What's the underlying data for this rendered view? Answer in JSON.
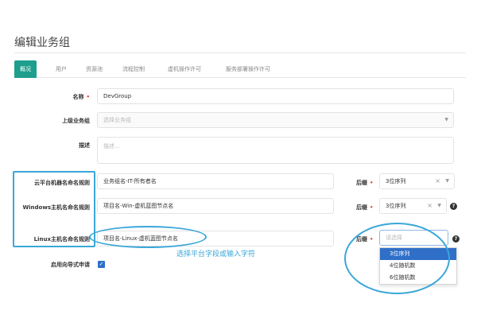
{
  "page": {
    "title": "编辑业务组"
  },
  "tabs": [
    {
      "label": "概况",
      "active": true
    },
    {
      "label": "用户",
      "active": false
    },
    {
      "label": "资源池",
      "active": false
    },
    {
      "label": "流程控制",
      "active": false
    },
    {
      "label": "虚机操作许可",
      "active": false
    },
    {
      "label": "服务部署操作许可",
      "active": false
    }
  ],
  "form": {
    "name": {
      "label": "名称",
      "required": true,
      "value": "DevGroup"
    },
    "parent_group": {
      "label": "上级业务组",
      "placeholder": "选择业务组"
    },
    "description": {
      "label": "描述",
      "placeholder": "描述..."
    },
    "cloud_naming": {
      "label": "云平台机器名命名规则",
      "value": "业务组名-IT-所有者名",
      "suffix_label": "后缀",
      "suffix_value": "3位序列"
    },
    "windows_naming": {
      "label": "Windows主机名命名规则",
      "value": "项目名-Win-虚机蓝图节点名",
      "suffix_label": "后缀",
      "suffix_value": "3位序列"
    },
    "linux_naming": {
      "label": "Linux主机名命名规则",
      "value": "项目名-Linux-虚机蓝图节点名",
      "suffix_label": "后缀",
      "suffix_placeholder": "请选择"
    },
    "wizard": {
      "label": "启用向导式申请",
      "checked": true
    }
  },
  "dropdown": {
    "options": [
      "3位序列",
      "4位随机数",
      "6位随机数"
    ],
    "selected_index": 0
  },
  "annotation": {
    "text": "选择平台字段或输入字符"
  },
  "icons": {
    "clear": "×",
    "caret": "▼",
    "help": "?",
    "check": "✓"
  },
  "colors": {
    "accent_tab": "#1e9e8c",
    "required": "#e04a4a",
    "dropdown_selected": "#2f6fc8",
    "annotation": "#3aa7d9"
  }
}
